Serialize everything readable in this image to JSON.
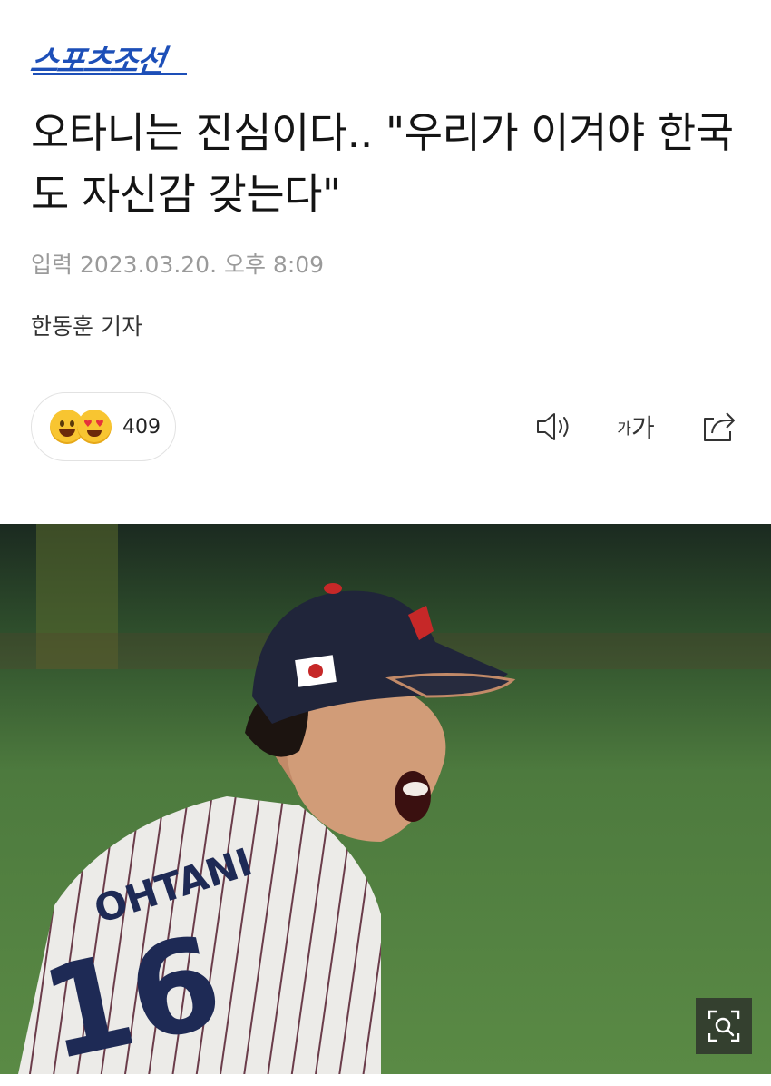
{
  "brand": {
    "logo_text": "스포츠조선",
    "color": "#1d4fb8"
  },
  "article": {
    "headline": "오타니는 진심이다.. \"우리가 이겨야 한국도 자신감 갖는다\"",
    "date": "입력 2023.03.20. 오후 8:09",
    "author": "한동훈 기자"
  },
  "reactions": {
    "count": "409",
    "icons": [
      "grinning-emoji",
      "heart-eyes-emoji"
    ]
  },
  "toolbar": {
    "tts_icon": "speaker-icon",
    "font_size": {
      "small": "가",
      "large": "가"
    },
    "share_icon": "share-icon"
  },
  "photo": {
    "jersey_name": "OHTANI",
    "jersey_number": "16",
    "zoom_icon": "zoom-icon"
  }
}
